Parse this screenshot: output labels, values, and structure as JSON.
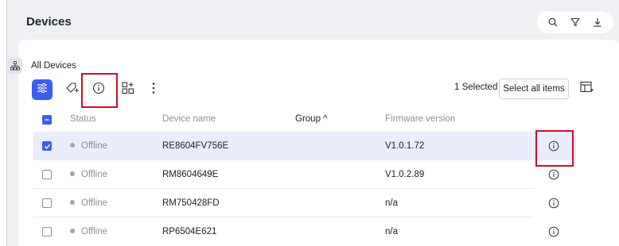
{
  "header": {
    "title": "Devices",
    "tools": [
      "search-icon",
      "filter-icon",
      "download-icon"
    ]
  },
  "breadcrumb": {
    "label": "All Devices"
  },
  "toolbar": {
    "buttons": [
      "filter-settings-icon",
      "add-tag-icon",
      "info-icon",
      "add-widget-icon",
      "more-vertical-icon"
    ],
    "selected_text": "1 Selected",
    "select_all_label": "Select all items"
  },
  "table": {
    "headers": {
      "status": "Status",
      "device_name": "Device name",
      "group": "Group ^",
      "firmware": "Firmware version"
    },
    "rows": [
      {
        "checked": true,
        "status": "Offline",
        "device_name": "RE8604FV756E",
        "group": "",
        "firmware": "V1.0.1.72"
      },
      {
        "checked": false,
        "status": "Offline",
        "device_name": "RM8604649E",
        "group": "",
        "firmware": "V1.0.2.89"
      },
      {
        "checked": false,
        "status": "Offline",
        "device_name": "RM750428FD",
        "group": "",
        "firmware": "n/a"
      },
      {
        "checked": false,
        "status": "Offline",
        "device_name": "RP6504E621",
        "group": "",
        "firmware": "n/a"
      }
    ]
  },
  "colors": {
    "accent": "#3b5ef0",
    "highlight": "#c8102e",
    "selected_row": "#e9edfc"
  }
}
